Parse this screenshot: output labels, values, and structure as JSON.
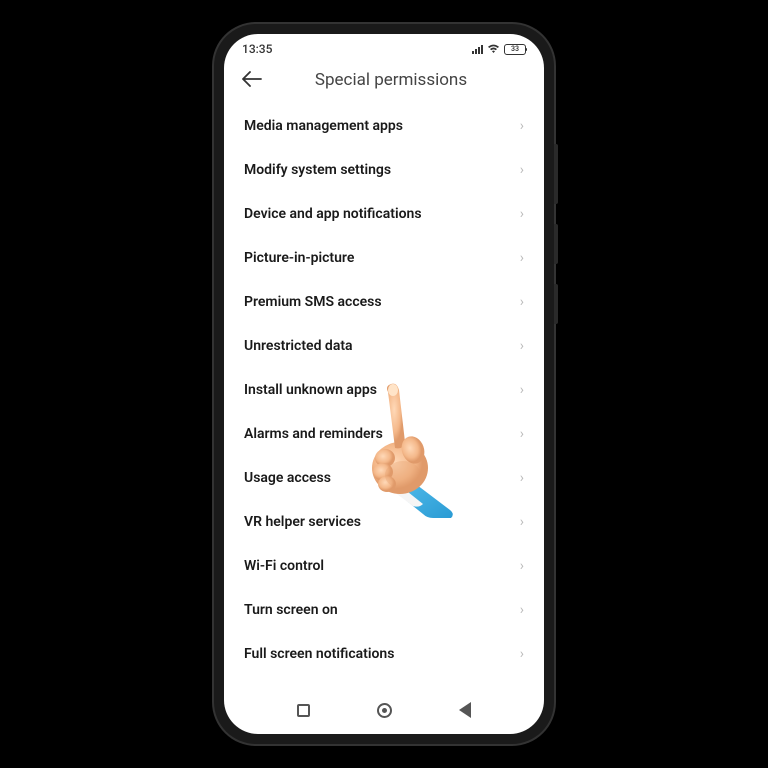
{
  "statusBar": {
    "time": "13:35",
    "batteryLevel": "33"
  },
  "header": {
    "title": "Special permissions"
  },
  "permissions": [
    {
      "label": "Media management apps"
    },
    {
      "label": "Modify system settings"
    },
    {
      "label": "Device and app notifications"
    },
    {
      "label": "Picture-in-picture"
    },
    {
      "label": "Premium SMS access"
    },
    {
      "label": "Unrestricted data"
    },
    {
      "label": "Install unknown apps"
    },
    {
      "label": "Alarms and reminders"
    },
    {
      "label": "Usage access"
    },
    {
      "label": "VR helper services"
    },
    {
      "label": "Wi-Fi control"
    },
    {
      "label": "Turn screen on"
    },
    {
      "label": "Full screen notifications"
    }
  ]
}
